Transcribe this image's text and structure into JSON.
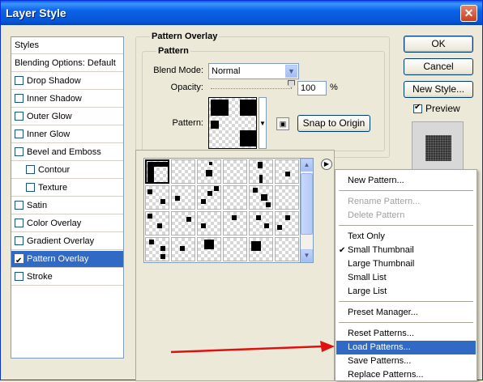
{
  "window": {
    "title": "Layer Style",
    "close_glyph": "✕"
  },
  "styles_panel": {
    "header": "Styles",
    "blending": "Blending Options: Default",
    "items": [
      {
        "label": "Drop Shadow",
        "checked": false
      },
      {
        "label": "Inner Shadow",
        "checked": false
      },
      {
        "label": "Outer Glow",
        "checked": false
      },
      {
        "label": "Inner Glow",
        "checked": false
      },
      {
        "label": "Bevel and Emboss",
        "checked": false
      },
      {
        "label": "Contour",
        "checked": false
      },
      {
        "label": "Texture",
        "checked": false
      },
      {
        "label": "Satin",
        "checked": false
      },
      {
        "label": "Color Overlay",
        "checked": false
      },
      {
        "label": "Gradient Overlay",
        "checked": false
      },
      {
        "label": "Pattern Overlay",
        "checked": true
      },
      {
        "label": "Stroke",
        "checked": false
      }
    ]
  },
  "pattern_overlay": {
    "group_title": "Pattern Overlay",
    "subgroup_title": "Pattern",
    "blend_mode_label": "Blend Mode:",
    "blend_mode_value": "Normal",
    "opacity_label": "Opacity:",
    "opacity_value": "100",
    "opacity_unit": "%",
    "pattern_label": "Pattern:",
    "snap_button": "Snap to Origin"
  },
  "buttons": {
    "ok": "OK",
    "cancel": "Cancel",
    "new_style": "New Style...",
    "preview": "Preview",
    "preview_checked": true
  },
  "context_menu": {
    "items": [
      {
        "label": "New Pattern...",
        "disabled": false
      },
      {
        "label": "Rename Pattern...",
        "disabled": true
      },
      {
        "label": "Delete Pattern",
        "disabled": true
      },
      {
        "label": "Text Only",
        "disabled": false
      },
      {
        "label": "Small Thumbnail",
        "disabled": false,
        "checked": true
      },
      {
        "label": "Large Thumbnail",
        "disabled": false
      },
      {
        "label": "Small List",
        "disabled": false
      },
      {
        "label": "Large List",
        "disabled": false
      },
      {
        "label": "Preset Manager...",
        "disabled": false
      },
      {
        "label": "Reset Patterns...",
        "disabled": false
      },
      {
        "label": "Load Patterns...",
        "disabled": false,
        "highlighted": true
      },
      {
        "label": "Save Patterns...",
        "disabled": false
      },
      {
        "label": "Replace Patterns...",
        "disabled": false
      }
    ]
  },
  "colors": {
    "titlebar": "#0a5dde",
    "selection": "#316ac5",
    "annotation_arrow": "#e01010"
  }
}
